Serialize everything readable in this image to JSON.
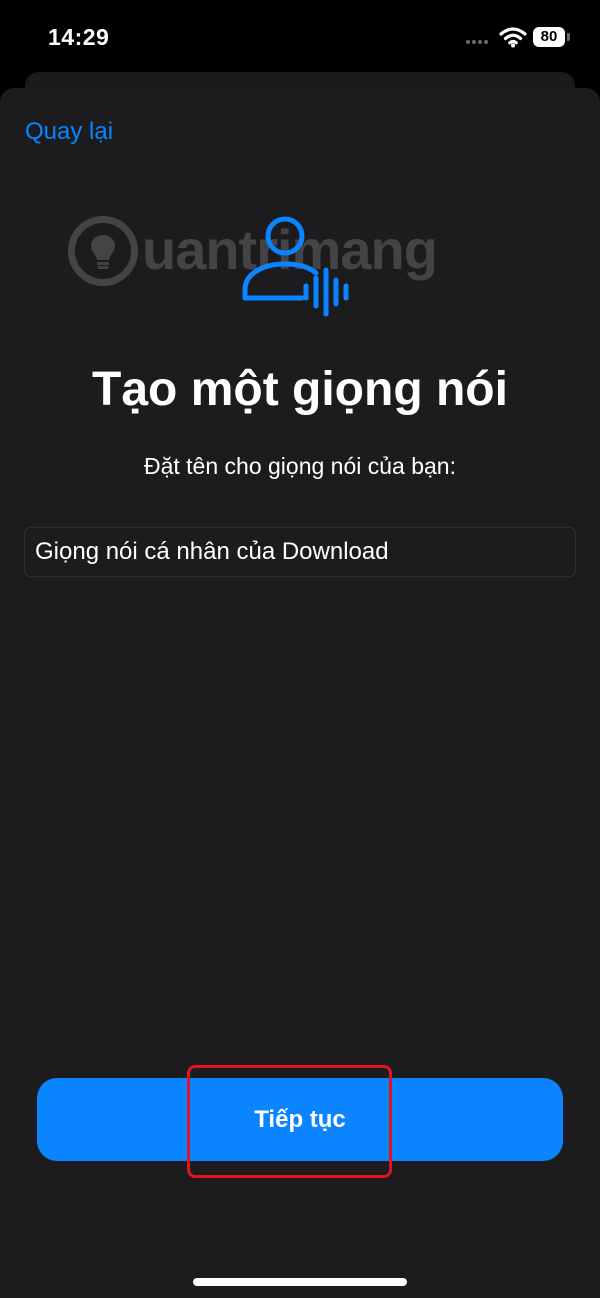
{
  "status_bar": {
    "time": "14:29",
    "battery": "80",
    "wifi_icon": "wifi-icon",
    "signal_icon": "signal-dots-icon"
  },
  "nav": {
    "back_label": "Quay lại"
  },
  "watermark": {
    "text": "uantrimang"
  },
  "header": {
    "icon": "person-voice-icon",
    "title": "Tạo một giọng nói",
    "subtitle": "Đặt tên cho giọng nói của bạn:"
  },
  "form": {
    "name_value": "Giọng nói cá nhân của Download"
  },
  "actions": {
    "continue_label": "Tiếp tục"
  },
  "colors": {
    "accent": "#0a84ff",
    "sheet_background": "#1c1c1e",
    "highlight": "#e0141e"
  }
}
